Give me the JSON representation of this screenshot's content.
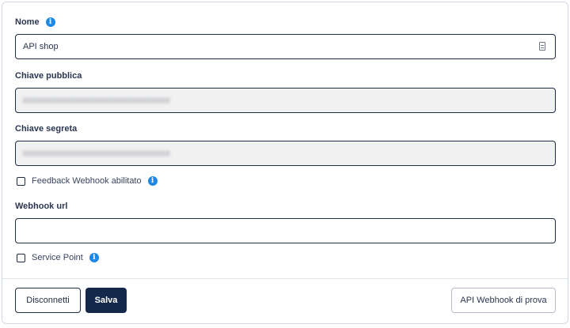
{
  "form": {
    "name": {
      "label": "Nome",
      "value": "API shop"
    },
    "public_key": {
      "label": "Chiave pubblica",
      "value_obscured": "xxxxxxxxxxxxxxxxxxxxxxxxxxxxxxx"
    },
    "secret_key": {
      "label": "Chiave segreta",
      "value_obscured": "xxxxxxxxxxxxxxxxxxxxxxxxxxxxxxx"
    },
    "feedback_webhook": {
      "label": "Feedback Webhook abilitato",
      "checked": false
    },
    "webhook_url": {
      "label": "Webhook url",
      "value": ""
    },
    "service_point": {
      "label": "Service Point",
      "checked": false
    }
  },
  "footer": {
    "disconnect_label": "Disconnetti",
    "save_label": "Salva",
    "test_webhook_label": "API Webhook di prova"
  },
  "icons": {
    "info": "info-icon",
    "field_action": "document-icon"
  },
  "colors": {
    "primary": "#14284b",
    "info": "#1e88e5",
    "readonly_bg": "#f1f1f1"
  }
}
